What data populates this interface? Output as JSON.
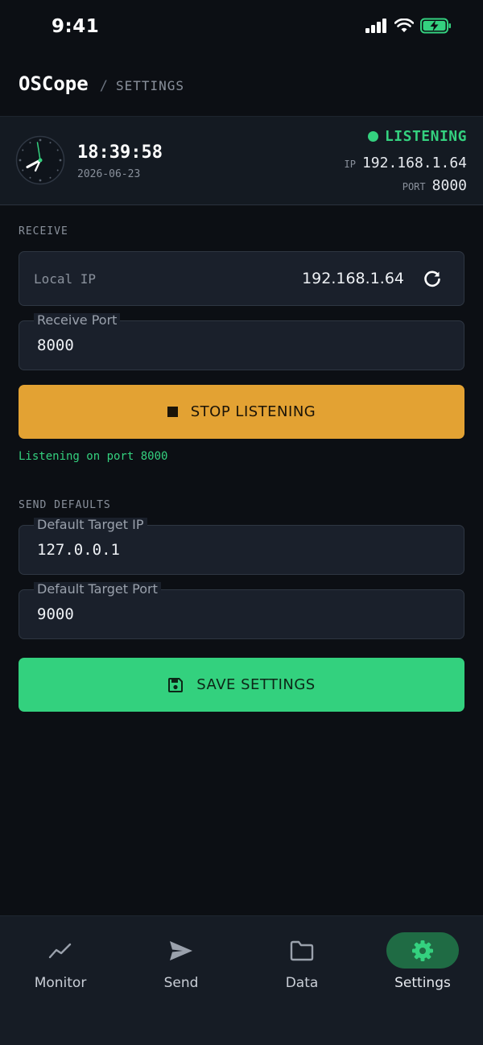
{
  "status_bar": {
    "time": "9:41"
  },
  "header": {
    "app_name": "OSCope",
    "separator": "/",
    "page": "SETTINGS"
  },
  "info": {
    "time": "18:39:58",
    "date": "2026-06-23",
    "status": "LISTENING",
    "ip_label": "IP",
    "ip": "192.168.1.64",
    "port_label": "PORT",
    "port": "8000",
    "status_color": "#34d17f"
  },
  "receive": {
    "section_title": "RECEIVE",
    "local_ip_label": "Local IP",
    "local_ip_value": "192.168.1.64",
    "port_label": "Receive Port",
    "port_value": "8000",
    "stop_button": "STOP LISTENING",
    "listening_message": "Listening on port 8000"
  },
  "send_defaults": {
    "section_title": "SEND DEFAULTS",
    "target_ip_label": "Default Target IP",
    "target_ip_value": "127.0.0.1",
    "target_port_label": "Default Target Port",
    "target_port_value": "9000",
    "save_button": "SAVE SETTINGS"
  },
  "nav": {
    "items": [
      {
        "label": "Monitor",
        "icon": "chart-line-icon"
      },
      {
        "label": "Send",
        "icon": "send-icon"
      },
      {
        "label": "Data",
        "icon": "folder-icon"
      },
      {
        "label": "Settings",
        "icon": "gear-icon",
        "active": true
      }
    ]
  },
  "colors": {
    "accent_green": "#33d17e",
    "accent_amber": "#e3a233",
    "background": "#0c0f14"
  }
}
